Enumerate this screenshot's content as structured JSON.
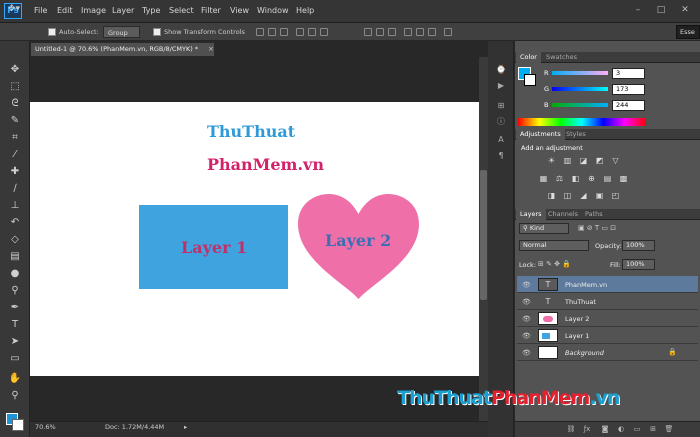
{
  "app": {
    "logo": "Ps"
  },
  "menu": [
    "File",
    "Edit",
    "Image",
    "Layer",
    "Type",
    "Select",
    "Filter",
    "View",
    "Window",
    "Help"
  ],
  "window_controls": [
    "–",
    "□",
    "✕"
  ],
  "options_bar": {
    "auto_select_label": "Auto-Select:",
    "auto_select_value": "Group",
    "show_transform_label": "Show Transform Controls",
    "workspace_label": "Esse"
  },
  "document": {
    "tab_title": "Untitled-1 @ 70.6% (PhanMem.vn, RGB/8/CMYK) *",
    "zoom": "70.6%",
    "doc_info": "Doc: 1.72M/4.44M",
    "title_line1": "ThuThuat",
    "title_line2": "PhanMem.vn",
    "layer1_text": "Layer 1",
    "layer2_text": "Layer 2",
    "colors": {
      "blue": "#3fa3e0",
      "heart": "#ef6fa8",
      "title1": "#2e9bd6",
      "title2": "#d3226a",
      "layer_text": "#c2306a",
      "layer2_text": "#3a6fb5"
    }
  },
  "color_panel": {
    "tabs": [
      "Color",
      "Swatches"
    ],
    "channels": [
      {
        "label": "R",
        "value": "3"
      },
      {
        "label": "G",
        "value": "173"
      },
      {
        "label": "B",
        "value": "244"
      }
    ],
    "fg_color": "#03adf4"
  },
  "adjustments_panel": {
    "tabs": [
      "Adjustments",
      "Styles"
    ],
    "heading": "Add an adjustment",
    "row1": [
      "☀",
      "▥",
      "◪",
      "◩",
      "▽"
    ],
    "row2": [
      "▦",
      "⚖",
      "◧",
      "⊕",
      "▤",
      "▩"
    ],
    "row3": [
      "◨",
      "◫",
      "◢",
      "▣",
      "◰"
    ]
  },
  "layers_panel": {
    "tabs": [
      "Layers",
      "Channels",
      "Paths"
    ],
    "filter": "Kind",
    "blend_mode": "Normal",
    "opacity_label": "Opacity:",
    "opacity": "100%",
    "lock_label": "Lock:",
    "fill_label": "Fill:",
    "fill": "100%",
    "layers": [
      {
        "name": "PhanMem.vn",
        "type": "text",
        "selected": true
      },
      {
        "name": "ThuThuat",
        "type": "text",
        "selected": false
      },
      {
        "name": "Layer 2",
        "type": "image",
        "selected": false
      },
      {
        "name": "Layer 1",
        "type": "image",
        "selected": false
      },
      {
        "name": "Background",
        "type": "background",
        "selected": false
      }
    ]
  },
  "watermark": {
    "part1": "ThuThuat",
    "part2": "PhanMem",
    "part3": ".vn"
  }
}
